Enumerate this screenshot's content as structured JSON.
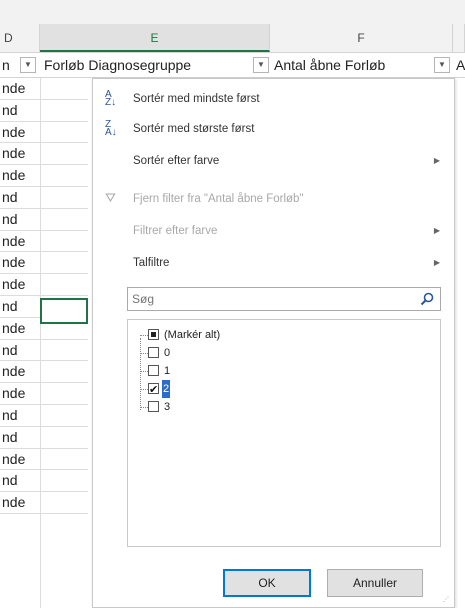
{
  "columns": {
    "d": "D",
    "e": "E",
    "f": "F"
  },
  "header": {
    "d_cell": "n",
    "e_cell": "Forløb Diagnosegruppe",
    "f_cell": "Antal åbne Forløb",
    "g_cell": "A"
  },
  "left_cells": [
    "nde",
    "nd",
    "nde",
    "nde",
    "nde",
    "nd",
    "nd",
    "nde",
    "nde",
    "nde",
    "nd",
    "nde",
    "nd",
    "nde",
    "nde",
    "nd",
    "nd",
    "nde",
    "nd",
    "nde"
  ],
  "menu": {
    "sort_asc": "Sortér med mindste først",
    "sort_desc": "Sortér med største først",
    "sort_color": "Sortér efter farve",
    "clear_filter": "Fjern filter fra \"Antal åbne Forløb\"",
    "filter_color": "Filtrer efter farve",
    "number_filters": "Talfiltre"
  },
  "search": {
    "placeholder": "Søg"
  },
  "values": [
    {
      "label": "(Markér alt)",
      "state": "indeterminate"
    },
    {
      "label": "0",
      "state": "unchecked"
    },
    {
      "label": "1",
      "state": "unchecked"
    },
    {
      "label": "2",
      "state": "checked"
    },
    {
      "label": "3",
      "state": "unchecked"
    }
  ],
  "buttons": {
    "ok": "OK",
    "cancel": "Annuller"
  },
  "colors": {
    "excel_green": "#217346",
    "focus_blue": "#0078d7"
  }
}
